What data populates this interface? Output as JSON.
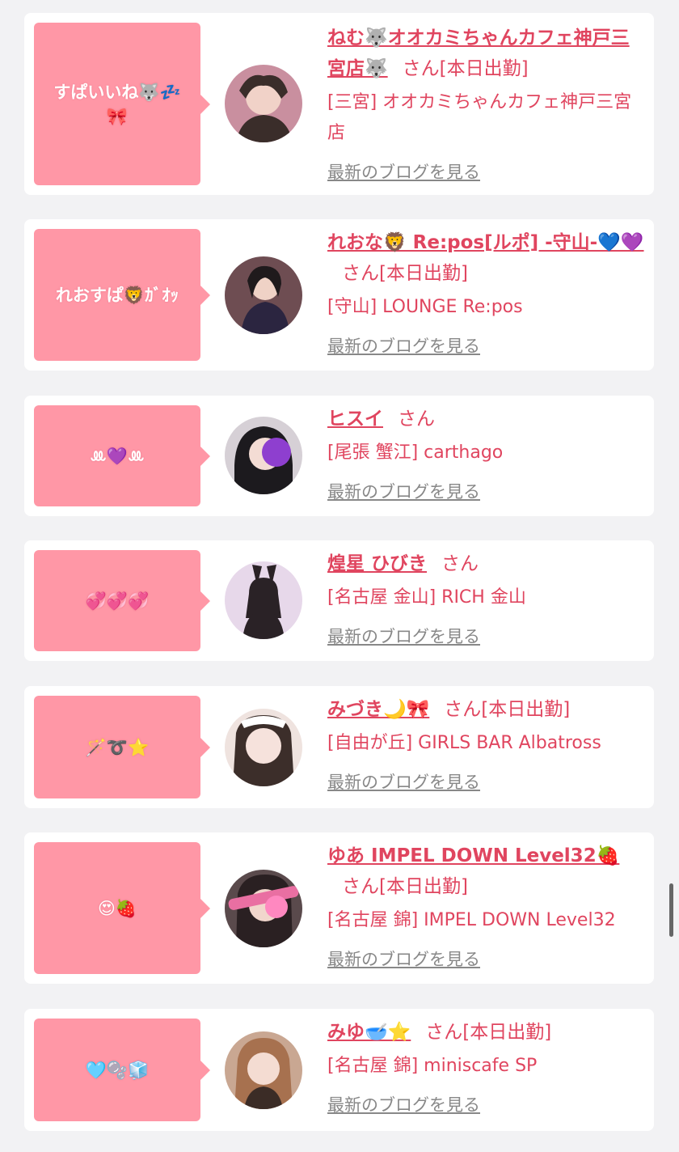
{
  "entries": [
    {
      "bubble_lines": [
        "すぱいいね🐺💤",
        "🎀"
      ],
      "name": "ねむ🐺オオカミちゃんカフェ神戸三宮店🐺",
      "suffix": "さん[本日出勤]",
      "shop": "[三宮] オオカミちゃんカフェ神戸三宮店",
      "blog_link": "最新のブログを見る",
      "avatar_colors": [
        "#c98f9f",
        "#3a2d2a"
      ]
    },
    {
      "bubble_lines": [
        "れおすぱ🦁ｶﾞｵｯ"
      ],
      "name": "れおな🦁 Re:pos[ルポ] -守山-💙💜",
      "suffix": "さん[本日出勤]",
      "shop": "[守山] LOUNGE Re:pos",
      "blog_link": "最新のブログを見る",
      "avatar_colors": [
        "#6e4d52",
        "#2b2540"
      ]
    },
    {
      "bubble_lines": [
        "ꔛ💜ꔛ"
      ],
      "name": "ヒスイ",
      "suffix": "さん",
      "shop": "[尾張 蟹江] carthago",
      "blog_link": "最新のブログを見る",
      "avatar_colors": [
        "#d6d0d6",
        "#1c1a1e"
      ]
    },
    {
      "bubble_lines": [
        "💞💞💞"
      ],
      "name": "煌星 ひびき",
      "suffix": "さん",
      "shop": "[名古屋 金山] RICH 金山",
      "blog_link": "最新のブログを見る",
      "avatar_colors": [
        "#e7d8ea",
        "#2a2226"
      ]
    },
    {
      "bubble_lines": [
        "🪄➰⭐"
      ],
      "name": "みづき🌙🎀",
      "suffix": "さん[本日出勤]",
      "shop": "[自由が丘] GIRLS BAR Albatross",
      "blog_link": "最新のブログを見る",
      "avatar_colors": [
        "#efe3df",
        "#3c2e2a"
      ]
    },
    {
      "bubble_lines": [
        "😍🍓"
      ],
      "name": "ゆあ IMPEL DOWN Level32🍓",
      "suffix": "さん[本日出勤]",
      "shop": "[名古屋 錦] IMPEL DOWN Level32",
      "blog_link": "最新のブログを見る",
      "avatar_colors": [
        "#5a4a4c",
        "#e96fa2"
      ]
    },
    {
      "bubble_lines": [
        "🩵🫧🧊"
      ],
      "name": "みゆ🥣⭐",
      "suffix": "さん[本日出勤]",
      "shop": "[名古屋 錦] miniscafe SP",
      "blog_link": "最新のブログを見る",
      "avatar_colors": [
        "#c9a792",
        "#3b2c26"
      ]
    }
  ]
}
